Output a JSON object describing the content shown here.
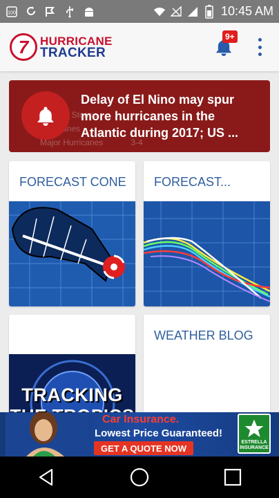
{
  "status_bar": {
    "time": "10:45 AM",
    "icons": [
      "sim-100-icon",
      "sync-icon",
      "check-flag-icon",
      "usb-icon",
      "android-icon",
      "wifi-icon",
      "no-signal-icon",
      "signal-icon",
      "battery-icon"
    ]
  },
  "app_bar": {
    "logo_number": "7",
    "logo_line1": "HURRICANE",
    "logo_line2": "TRACKER",
    "notification_badge": "9+",
    "brand_red": "#c8102e",
    "brand_blue": "#1f3b8f"
  },
  "news": {
    "headline": "Delay of El Nino may spur more hurricanes in the Atlantic during 2017; US ...",
    "background_rows": [
      "Tropical Storms",
      "Hurricanes",
      "Major Hurricanes"
    ],
    "background_values": [
      "",
      "",
      "3-4"
    ]
  },
  "tiles": [
    {
      "title": "FORECAST CONE"
    },
    {
      "title": "FORECAST..."
    },
    {
      "title": "",
      "image_text_1": "TRACKING",
      "image_text_2": "THE TROPICS"
    },
    {
      "title": "WEATHER BLOG"
    }
  ],
  "ad": {
    "line1": "Car Insurance.",
    "line2": "Lowest Price Guaranteed!",
    "button": "GET A QUOTE NOW",
    "logo_text": "ESTRELLA INSURANCE"
  },
  "nav": {
    "back": "back-icon",
    "home": "home-icon",
    "recents": "recents-icon"
  }
}
